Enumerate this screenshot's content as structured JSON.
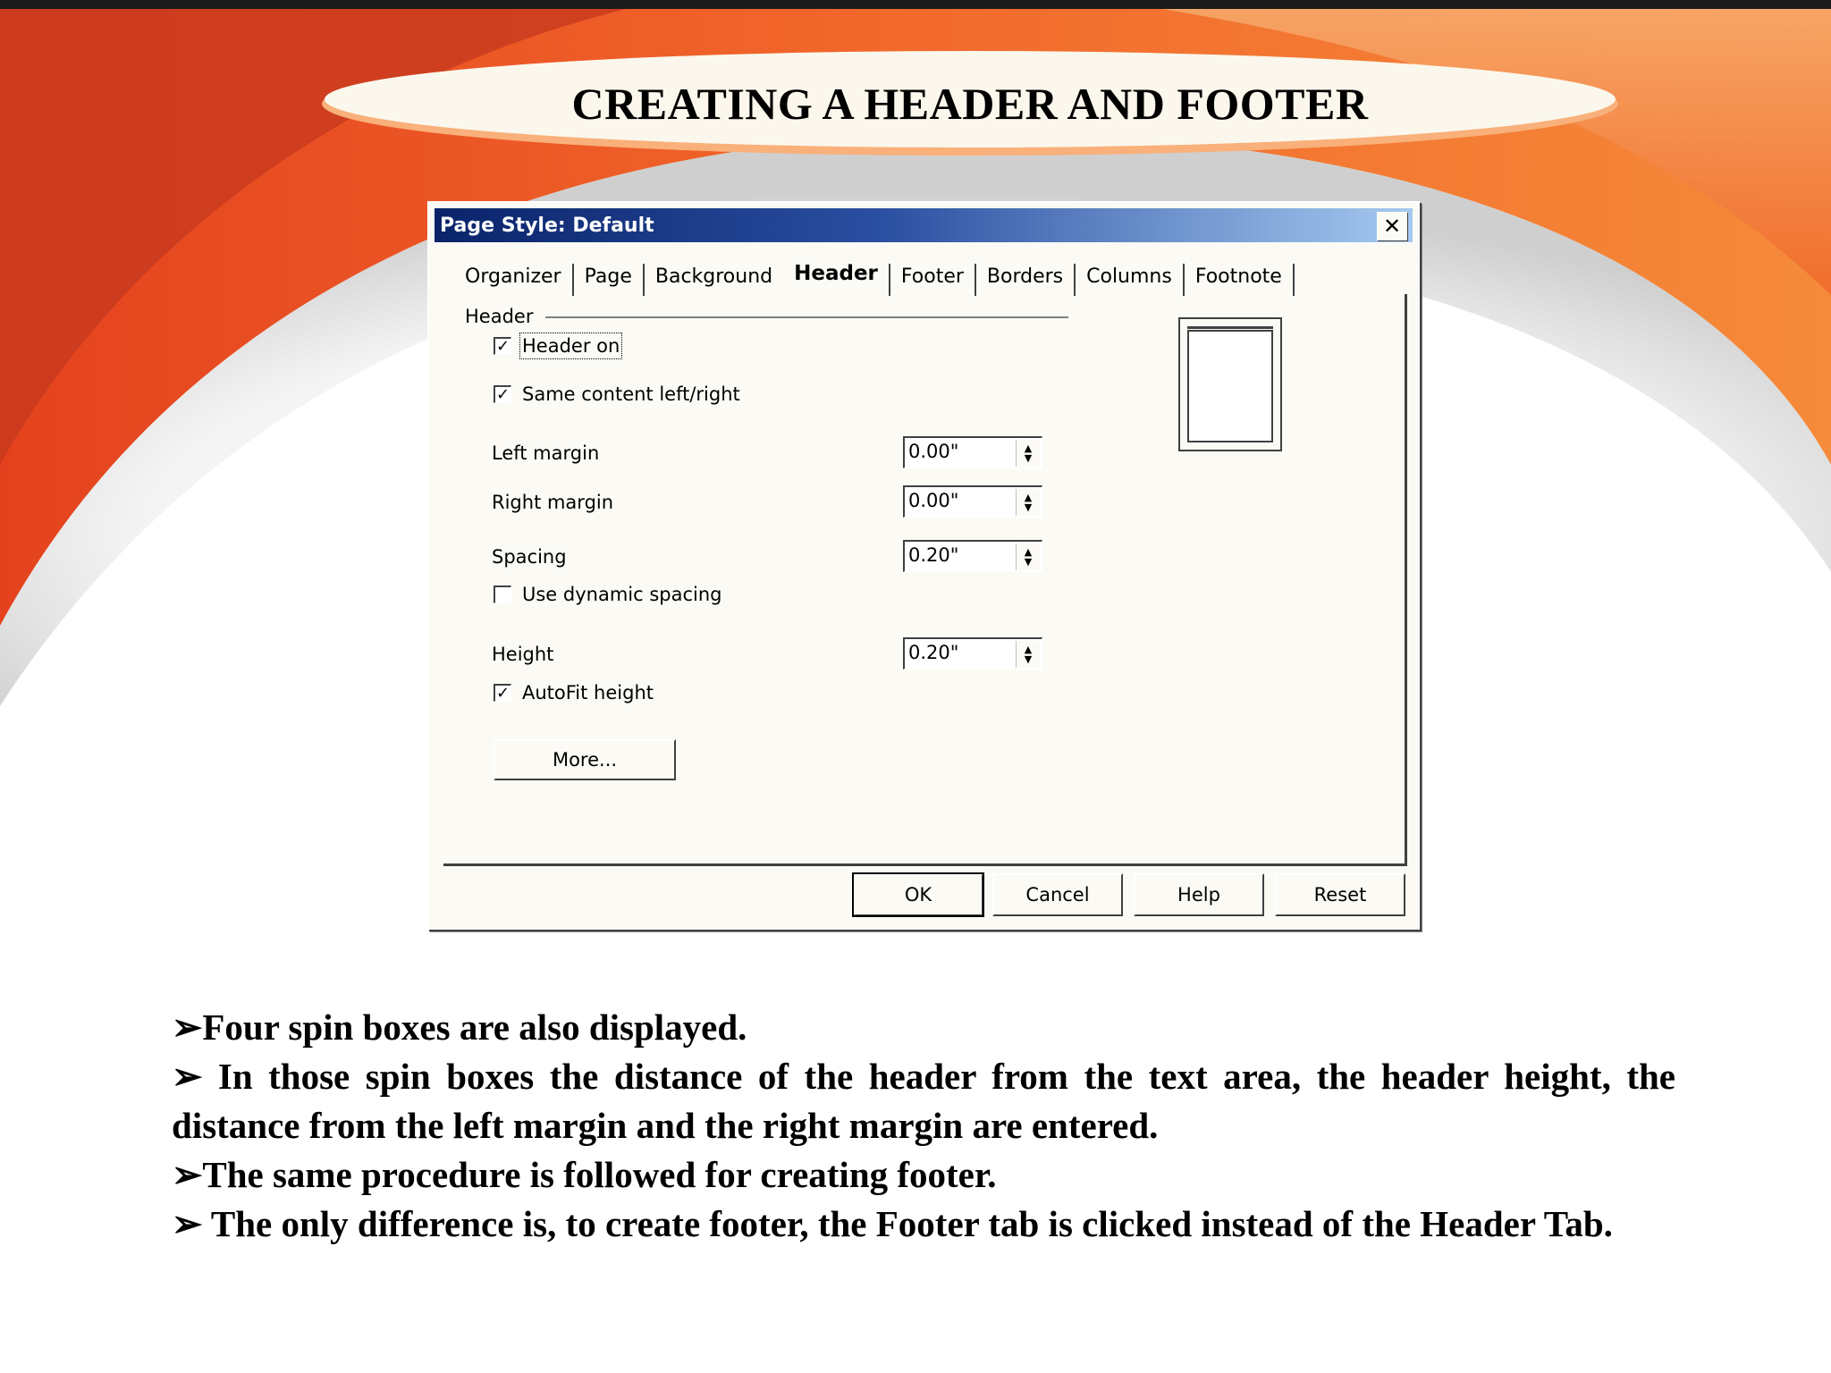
{
  "slide": {
    "title": "CREATING A HEADER AND FOOTER",
    "colors": {
      "accent_orange": "#f0602a",
      "accent_red": "#c8341e",
      "oval_fill": "#fbf7ec"
    }
  },
  "dialog": {
    "title": "Page Style: Default",
    "close_icon": "close-icon",
    "tabs": [
      {
        "label": "Organizer"
      },
      {
        "label": "Page"
      },
      {
        "label": "Background"
      },
      {
        "label": "Header",
        "active": true
      },
      {
        "label": "Footer"
      },
      {
        "label": "Borders"
      },
      {
        "label": "Columns"
      },
      {
        "label": "Footnote"
      }
    ],
    "group_label": "Header",
    "checkboxes": {
      "header_on": {
        "label": "Header on",
        "checked": true
      },
      "same_content": {
        "label": "Same content left/right",
        "checked": true
      },
      "dynamic_spacing": {
        "label": "Use dynamic spacing",
        "checked": false
      },
      "autofit": {
        "label": "AutoFit height",
        "checked": true
      }
    },
    "fields": {
      "left_margin": {
        "label": "Left margin",
        "value": "0.00\""
      },
      "right_margin": {
        "label": "Right margin",
        "value": "0.00\""
      },
      "spacing": {
        "label": "Spacing",
        "value": "0.20\""
      },
      "height": {
        "label": "Height",
        "value": "0.20\""
      }
    },
    "more_button": "More...",
    "buttons": {
      "ok": "OK",
      "cancel": "Cancel",
      "help": "Help",
      "reset": "Reset"
    }
  },
  "bullets": [
    "➢Four spin boxes are also displayed.",
    "➢ In those spin boxes the distance of the header from the text area, the header height, the distance from the left margin and the right margin are entered.",
    "➢The same procedure is followed for creating footer.",
    "➢ The only difference is, to create footer, the Footer tab is clicked instead of the Header Tab."
  ]
}
